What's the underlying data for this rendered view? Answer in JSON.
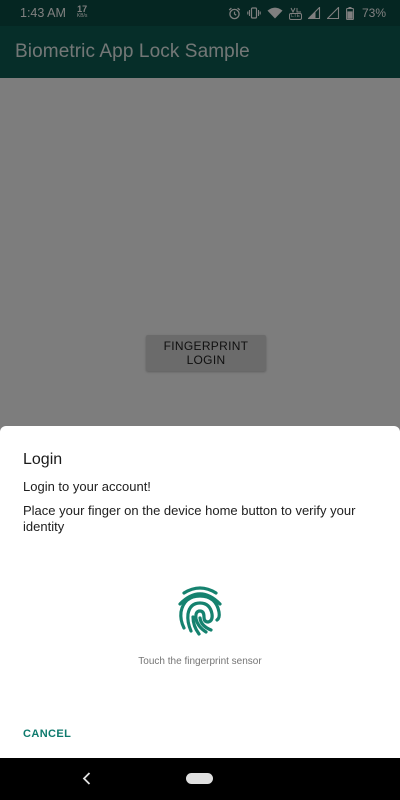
{
  "status_bar": {
    "time": "1:43 AM",
    "net_speed_value": "17",
    "net_speed_unit": "KB/s",
    "volte_label": "LTE",
    "battery_percent": "73%",
    "icons": [
      "alarm-icon",
      "vibrate-icon",
      "wifi-icon",
      "volte-icon",
      "signal-icon",
      "signal-icon",
      "battery-icon"
    ]
  },
  "app_bar": {
    "title": "Biometric App Lock Sample"
  },
  "main": {
    "fingerprint_login_label": "FINGERPRINT LOGIN"
  },
  "dialog": {
    "title": "Login",
    "subtitle": "Login to your account!",
    "description": "Place your finger on the device home button to verify your identity",
    "hint": "Touch the fingerprint sensor",
    "cancel_label": "CANCEL",
    "icon": "fingerprint-icon"
  },
  "nav_bar": {
    "icons": [
      "back-icon",
      "home-pill-icon"
    ]
  },
  "colors": {
    "status_bar": "#0b4d44",
    "app_bar": "#0c5c52",
    "accent": "#0e7a6d",
    "fingerprint": "#15826f"
  }
}
